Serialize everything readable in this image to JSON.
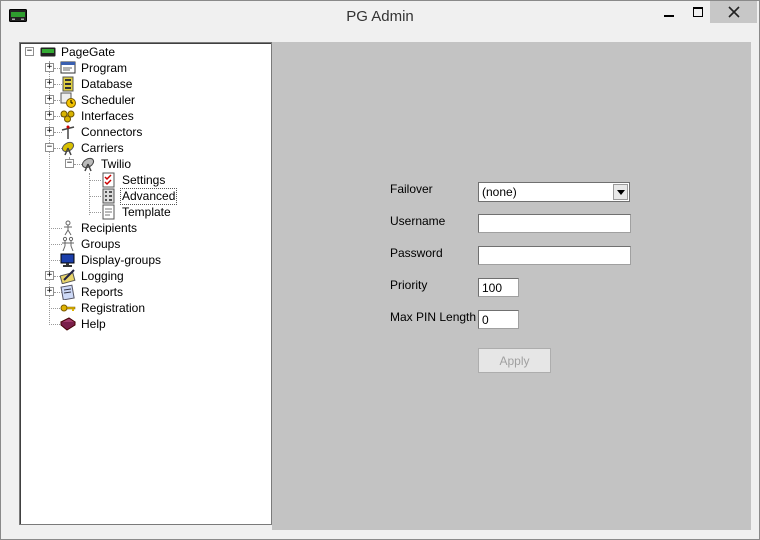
{
  "window": {
    "title": "PG Admin"
  },
  "tree": {
    "root": "PageGate",
    "items": [
      {
        "label": "Program",
        "icon": "program-icon",
        "expandable": true
      },
      {
        "label": "Database",
        "icon": "database-icon",
        "expandable": true
      },
      {
        "label": "Scheduler",
        "icon": "scheduler-icon",
        "expandable": true
      },
      {
        "label": "Interfaces",
        "icon": "interfaces-icon",
        "expandable": true
      },
      {
        "label": "Connectors",
        "icon": "connectors-icon",
        "expandable": true
      },
      {
        "label": "Carriers",
        "icon": "carriers-icon",
        "expandable": true,
        "expanded": true
      },
      {
        "label": "Recipients",
        "icon": "recipients-icon",
        "expandable": false
      },
      {
        "label": "Groups",
        "icon": "groups-icon",
        "expandable": false
      },
      {
        "label": "Display-groups",
        "icon": "display-groups-icon",
        "expandable": false
      },
      {
        "label": "Logging",
        "icon": "logging-icon",
        "expandable": true
      },
      {
        "label": "Reports",
        "icon": "reports-icon",
        "expandable": true
      },
      {
        "label": "Registration",
        "icon": "key-icon",
        "expandable": false
      },
      {
        "label": "Help",
        "icon": "help-book-icon",
        "expandable": false
      }
    ],
    "carrier": "Twilio",
    "carrier_children": [
      {
        "label": "Settings",
        "icon": "settings-icon"
      },
      {
        "label": "Advanced",
        "icon": "advanced-icon",
        "selected": true
      },
      {
        "label": "Template",
        "icon": "template-icon"
      }
    ]
  },
  "form": {
    "failover_label": "Failover",
    "failover_value": "(none)",
    "username_label": "Username",
    "username_value": "",
    "password_label": "Password",
    "password_value": "",
    "priority_label": "Priority",
    "priority_value": "100",
    "max_pin_label": "Max PIN Length",
    "max_pin_value": "0",
    "apply_label": "Apply"
  },
  "colors": {
    "content_bg": "#c3c3c3",
    "window_bg": "#f0f0f0"
  }
}
